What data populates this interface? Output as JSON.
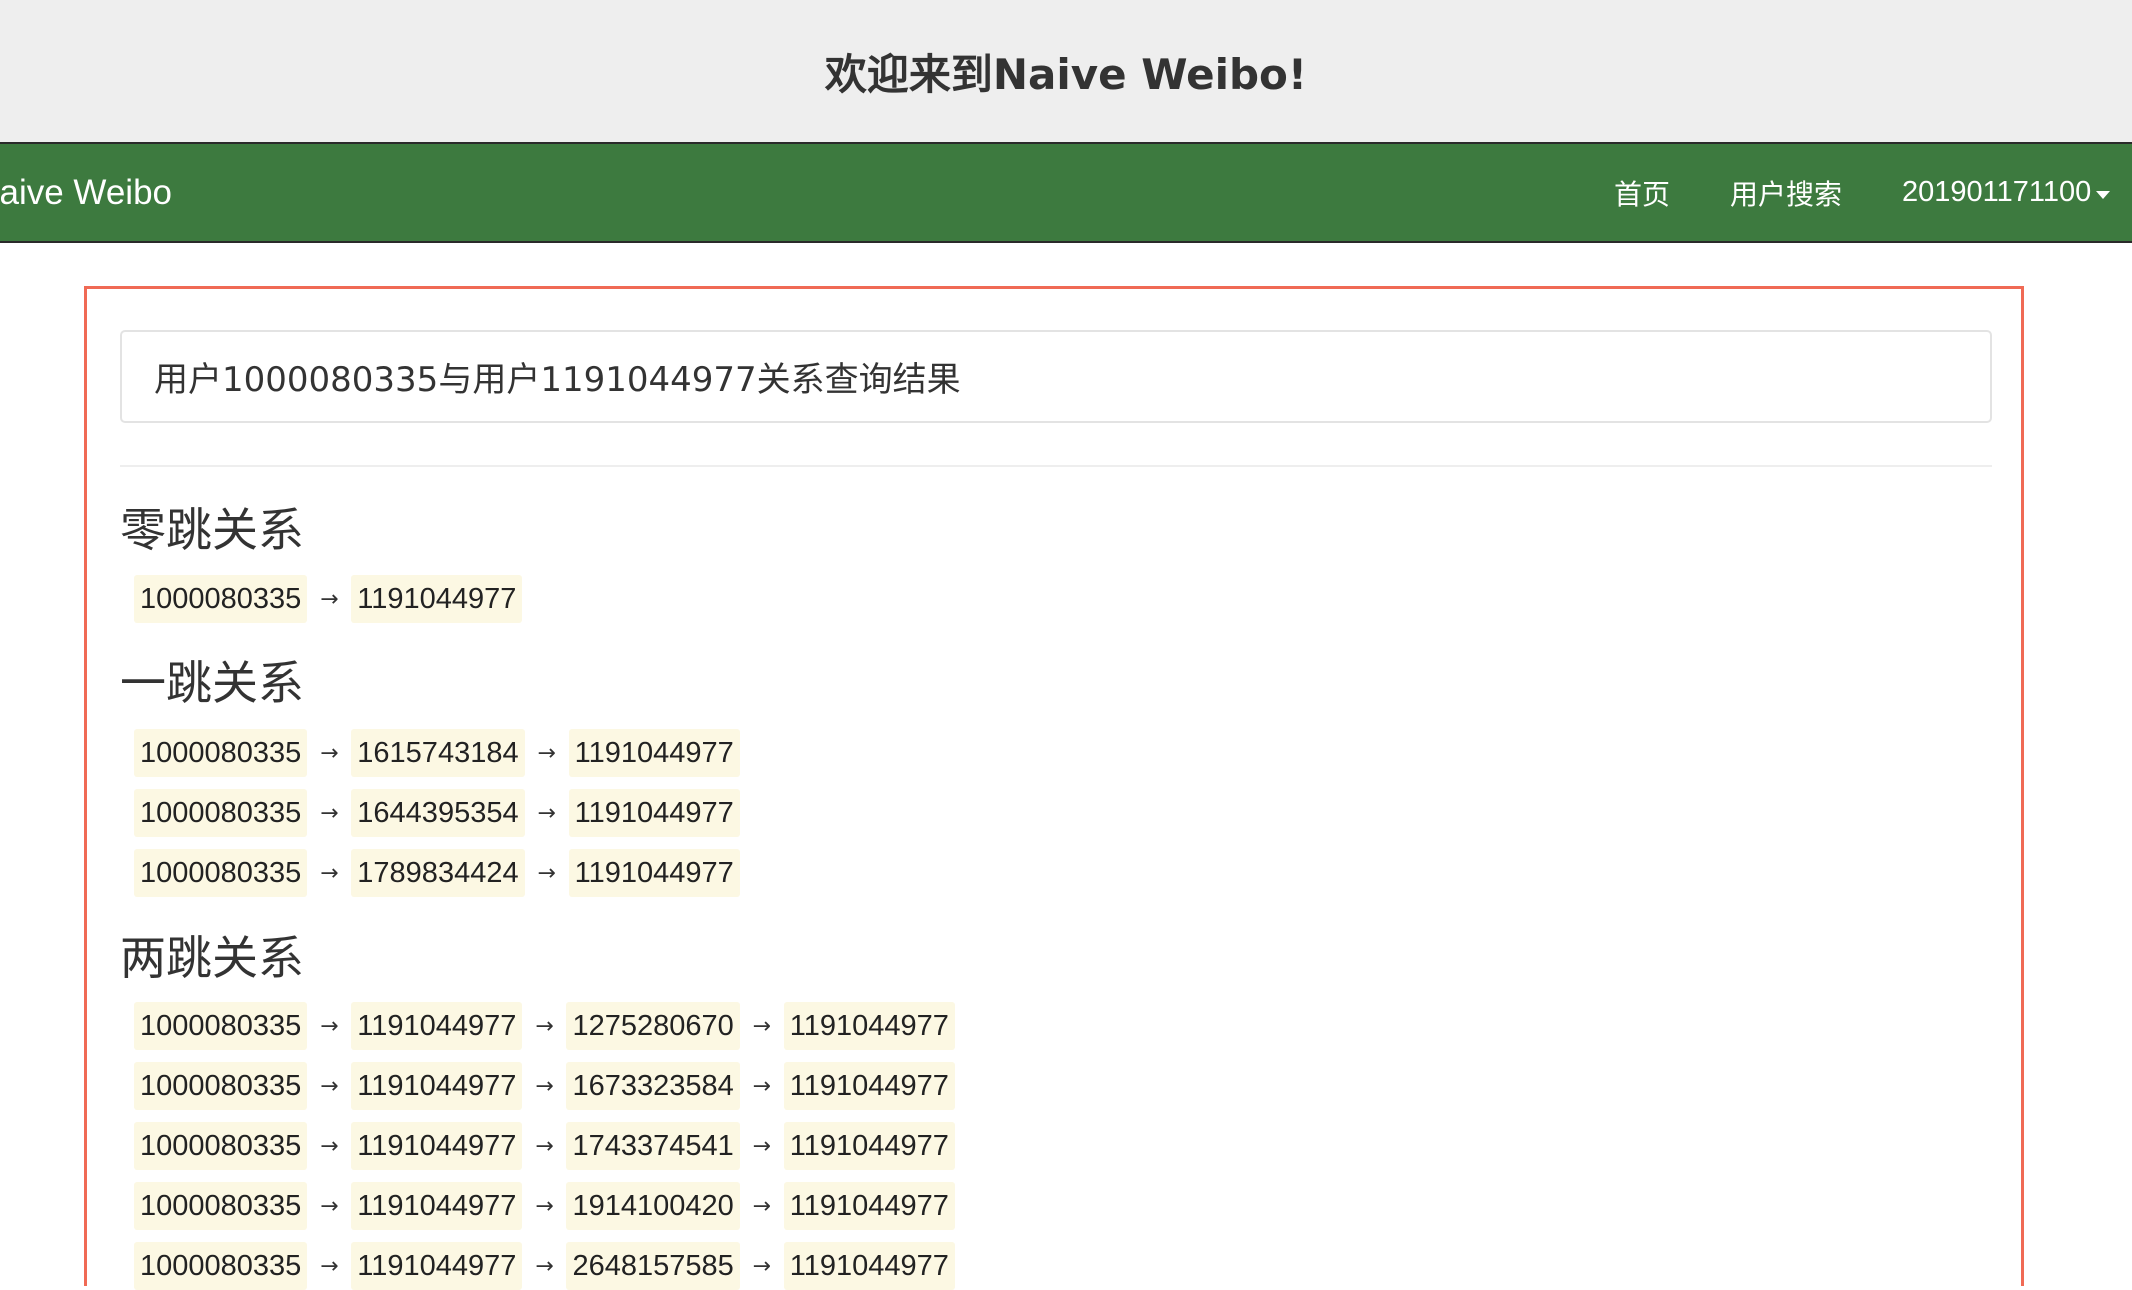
{
  "banner": {
    "title": "欢迎来到Naive Weibo!"
  },
  "navbar": {
    "brand": "Naive Weibo",
    "home": "首页",
    "user_search": "用户搜索",
    "username": "201901171100",
    "colors": {
      "background": "#3d7a3f",
      "text": "#ffffff"
    }
  },
  "panel": {
    "query_title": "用户1000080335与用户1191044977关系查询结果",
    "border_color": "#f06a55",
    "sections": [
      {
        "title": "零跳关系",
        "paths": [
          [
            "1000080335",
            "1191044977"
          ]
        ]
      },
      {
        "title": "一跳关系",
        "paths": [
          [
            "1000080335",
            "1615743184",
            "1191044977"
          ],
          [
            "1000080335",
            "1644395354",
            "1191044977"
          ],
          [
            "1000080335",
            "1789834424",
            "1191044977"
          ]
        ]
      },
      {
        "title": "两跳关系",
        "paths": [
          [
            "1000080335",
            "1191044977",
            "1275280670",
            "1191044977"
          ],
          [
            "1000080335",
            "1191044977",
            "1673323584",
            "1191044977"
          ],
          [
            "1000080335",
            "1191044977",
            "1743374541",
            "1191044977"
          ],
          [
            "1000080335",
            "1191044977",
            "1914100420",
            "1191044977"
          ],
          [
            "1000080335",
            "1191044977",
            "2648157585",
            "1191044977"
          ]
        ]
      }
    ]
  },
  "arrow_symbol": "→",
  "icons": {
    "user_menu": "caret-down-icon"
  }
}
